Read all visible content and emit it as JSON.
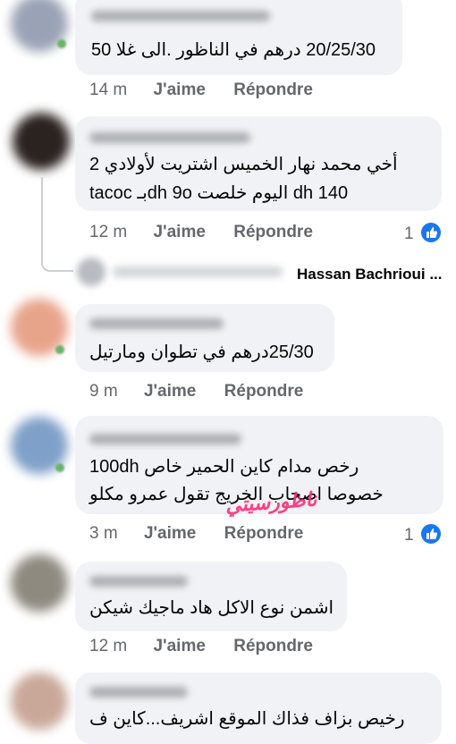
{
  "comments": [
    {
      "text_lines": [
        "20/25/30 درهم في الناظور .الى غلا 50"
      ],
      "time": "14 m",
      "like": "J'aime",
      "reply": "Répondre",
      "reactions": ""
    },
    {
      "text_lines": [
        "أخي  محمد نهار الخميس اشتريت لأولادي 2",
        "tacoc بـdh 9o اليوم خلصت dh 140"
      ],
      "time": "12 m",
      "like": "J'aime",
      "reply": "Répondre",
      "reactions": "1"
    },
    {
      "text_lines": [
        "25/30درهم في تطوان ومارتيل"
      ],
      "time": "9 m",
      "like": "J'aime",
      "reply": "Répondre",
      "reactions": ""
    },
    {
      "text_lines": [
        "رخص مدام كاين الحمير خاص 100dh",
        "خصوصا اصحاب الخريج تقول عمرو مكلو"
      ],
      "time": "3 m",
      "like": "J'aime",
      "reply": "Répondre",
      "reactions": "1"
    },
    {
      "text_lines": [
        "اشمن نوع الاكل هاد ماجيك شيكن"
      ],
      "time": "12 m",
      "like": "J'aime",
      "reply": "Répondre",
      "reactions": ""
    },
    {
      "text_lines": [
        "رخيص بزاف فذاك الموقع اشريف...كاين ف"
      ],
      "time": "",
      "like": "",
      "reply": "",
      "reactions": ""
    }
  ],
  "reply_preview": {
    "author": "Hassan Bachrioui ..."
  },
  "watermark": "ناظورسيتي",
  "colors": {
    "bubble": "#f0f2f5",
    "meta": "#65676b",
    "like_blue": "#1877f2",
    "watermark": "#ff2d78"
  },
  "icons": {
    "like": "like-thumb-icon"
  }
}
